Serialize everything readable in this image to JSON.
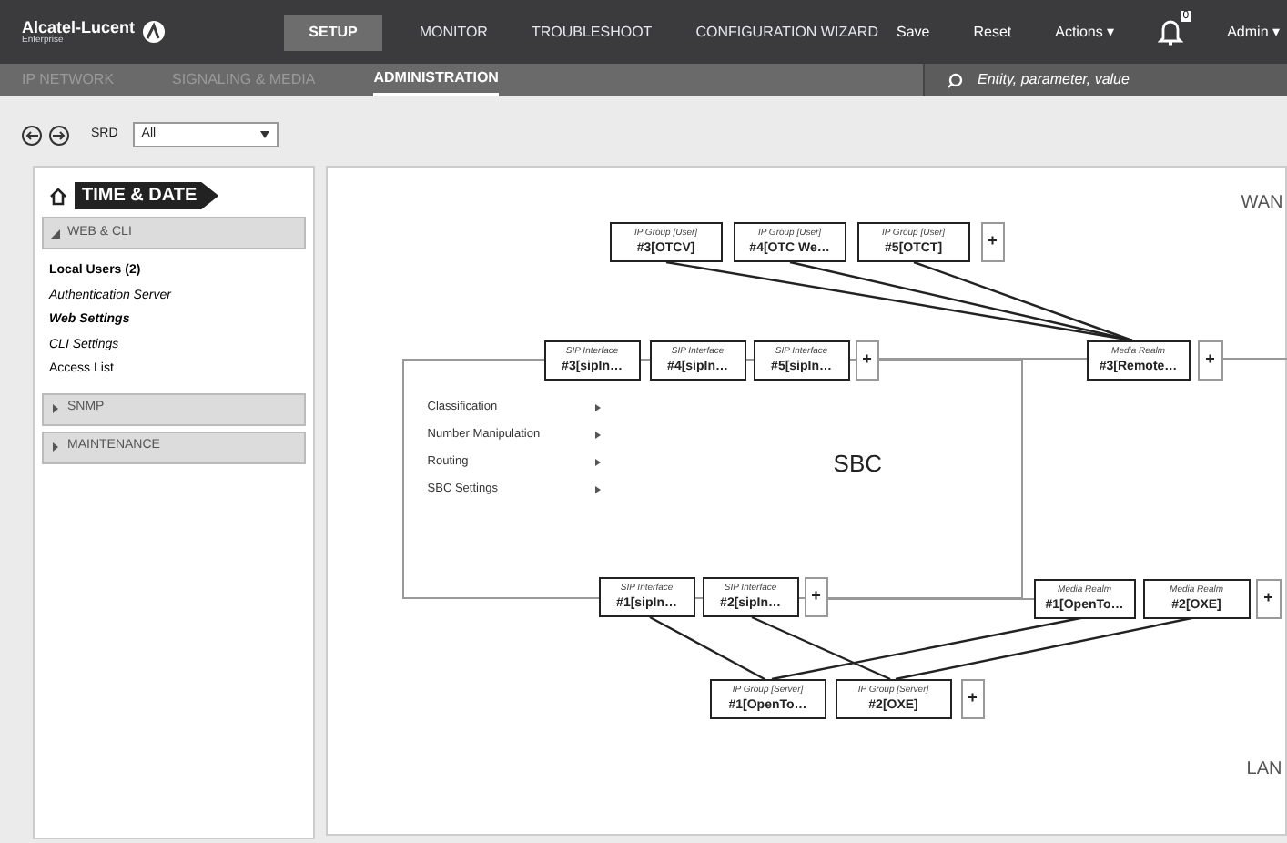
{
  "brand": {
    "name": "Alcatel-Lucent",
    "sub": "Enterprise"
  },
  "nav": [
    {
      "label": "SETUP",
      "selected": true
    },
    {
      "label": "MONITOR",
      "selected": false
    },
    {
      "label": "TROUBLESHOOT",
      "selected": false
    },
    {
      "label": "CONFIGURATION WIZARD",
      "selected": false
    }
  ],
  "actions": [
    "Save",
    "Reset",
    "Actions ▾"
  ],
  "notifications": "0",
  "user": "Admin ▾",
  "subnav": [
    {
      "label": "IP NETWORK",
      "selected": false
    },
    {
      "label": "SIGNALING & MEDIA",
      "selected": false
    },
    {
      "label": "ADMINISTRATION",
      "selected": true
    }
  ],
  "search": {
    "placeholder": "Entity, parameter, value"
  },
  "srd": {
    "label": "SRD",
    "value": "All"
  },
  "sidebar": {
    "title": "TIME & DATE",
    "sections": [
      {
        "label": "WEB & CLI",
        "expanded": true,
        "items": [
          {
            "label": "Local Users (2)",
            "kind": "bold"
          },
          {
            "label": "Authentication Server",
            "kind": "italic"
          },
          {
            "label": "Web Settings",
            "kind": "bold-italic"
          },
          {
            "label": "CLI Settings",
            "kind": "italic"
          },
          {
            "label": "Access List",
            "kind": "plain"
          }
        ]
      },
      {
        "label": "SNMP",
        "expanded": false
      },
      {
        "label": "MAINTENANCE",
        "expanded": false
      }
    ]
  },
  "diagram": {
    "zones": [
      "WAN",
      "LAN"
    ],
    "title": "SBC",
    "menu": [
      "Classification",
      "Number Manipulation",
      "Routing",
      "SBC Settings"
    ],
    "nodes": [
      {
        "kind": "entity",
        "type": "IP Group [User]",
        "name": "#3[OTCV]"
      },
      {
        "kind": "entity",
        "type": "IP Group [User]",
        "name": "#4[OTC We…"
      },
      {
        "kind": "entity",
        "type": "IP Group [User]",
        "name": "#5[OTCT]"
      },
      {
        "kind": "add",
        "label": "+"
      },
      {
        "kind": "entity",
        "type": "SIP Interface",
        "name": "#3[sipIn…"
      },
      {
        "kind": "entity",
        "type": "SIP Interface",
        "name": "#4[sipIn…"
      },
      {
        "kind": "entity",
        "type": "SIP Interface",
        "name": "#5[sipIn…"
      },
      {
        "kind": "add",
        "label": "+"
      },
      {
        "kind": "entity",
        "type": "Media Realm",
        "name": "#3[Remote…"
      },
      {
        "kind": "add",
        "label": "+"
      },
      {
        "kind": "entity",
        "type": "SIP Interface",
        "name": "#1[sipIn…"
      },
      {
        "kind": "entity",
        "type": "SIP Interface",
        "name": "#2[sipIn…"
      },
      {
        "kind": "add",
        "label": "+"
      },
      {
        "kind": "entity",
        "type": "Media Realm",
        "name": "#1[OpenTo…"
      },
      {
        "kind": "entity",
        "type": "Media Realm",
        "name": "#2[OXE]"
      },
      {
        "kind": "add",
        "label": "+"
      },
      {
        "kind": "entity",
        "type": "IP Group [Server]",
        "name": "#1[OpenTo…"
      },
      {
        "kind": "entity",
        "type": "IP Group [Server]",
        "name": "#2[OXE]"
      },
      {
        "kind": "add",
        "label": "+"
      }
    ]
  }
}
